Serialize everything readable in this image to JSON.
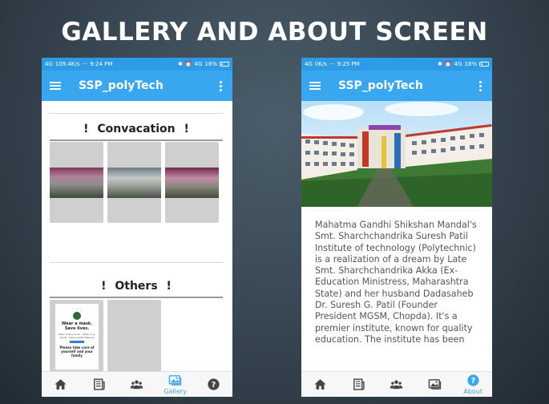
{
  "slide": {
    "title": "GALLERY AND ABOUT SCREEN"
  },
  "left_phone": {
    "status": {
      "network": "4G",
      "speed": "109.4K/s",
      "dots": "···",
      "time": "9:24 PM",
      "signal": "4G",
      "battery": "18%"
    },
    "appbar": {
      "title": "SSP_polyTech"
    },
    "sections": [
      {
        "title": "!   Convacation   !"
      },
      {
        "title": "!   Others   !"
      }
    ],
    "poster": {
      "head": "————",
      "line1": "Wear a mask.",
      "line2": "Save lives.",
      "small": "Wear a face cover · Wash your hands · Keep a safe distance",
      "care": "Please take care of yourself and your family"
    },
    "nav": [
      {
        "icon": "home-icon",
        "label": ""
      },
      {
        "icon": "newspaper-icon",
        "label": ""
      },
      {
        "icon": "people-icon",
        "label": ""
      },
      {
        "icon": "gallery-icon",
        "label": "Gallery",
        "active": true
      },
      {
        "icon": "help-icon",
        "label": ""
      }
    ]
  },
  "right_phone": {
    "status": {
      "network": "4G",
      "speed": "0K/s",
      "dots": "···",
      "time": "9:25 PM",
      "signal": "4G",
      "battery": "18%"
    },
    "appbar": {
      "title": "SSP_polyTech"
    },
    "about_text": "Mahatma Gandhi Shikshan Mandal's Smt. Sharchchandrika Suresh Patil Institute of technology (Polytechnic) is a realization of a dream by Late Smt. Sharchchandrika Akka (Ex-Education Ministress, Maharashtra State) and her husband Dadasaheb Dr. Suresh G. Patil (Founder President MGSM, Chopda). It's a premier institute, known for quality education. The institute has been",
    "nav": [
      {
        "icon": "home-icon",
        "label": ""
      },
      {
        "icon": "newspaper-icon",
        "label": ""
      },
      {
        "icon": "people-icon",
        "label": ""
      },
      {
        "icon": "gallery-icon",
        "label": ""
      },
      {
        "icon": "help-icon",
        "label": "About",
        "active": true
      }
    ]
  },
  "colors": {
    "accent": "#39a7f0",
    "statusbar": "#2e9be6",
    "icon_gray": "#444444",
    "tile_gray": "#cfcfcf"
  }
}
